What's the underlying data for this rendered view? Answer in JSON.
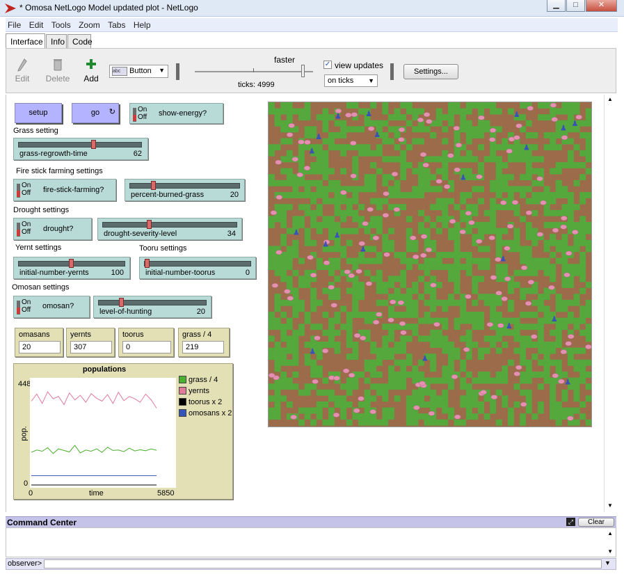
{
  "window": {
    "title": "* Omosa NetLogo Model updated plot - NetLogo",
    "min": "▁",
    "max": "□",
    "close": "✕"
  },
  "menu": [
    "File",
    "Edit",
    "Tools",
    "Zoom",
    "Tabs",
    "Help"
  ],
  "tabs": [
    "Interface",
    "Info",
    "Code"
  ],
  "toolbar": {
    "edit": "Edit",
    "delete": "Delete",
    "add": "Add",
    "widget_type": "Button",
    "faster": "faster",
    "speed": 0.93,
    "ticks": "ticks: 4999",
    "view_updates": "view updates",
    "update_mode": "on ticks",
    "settings": "Settings..."
  },
  "buttons": {
    "setup": "setup",
    "go": "go"
  },
  "switches": {
    "on": "On",
    "off": "Off",
    "show_energy": "show-energy?",
    "fire": "fire-stick-farming?",
    "drought": "drought?",
    "omosan": "omosan?"
  },
  "sections": {
    "grass": "Grass setting",
    "fire": "Fire stick farming settings",
    "drought": "Drought settings",
    "yernt": "Yernt settings",
    "tooru": "Tooru settings",
    "omosan": "Omosan settings"
  },
  "sliders": {
    "grass_regrowth": {
      "name": "grass-regrowth-time",
      "value": "62",
      "level": 0.62
    },
    "percent_burned": {
      "name": "percent-burned-grass",
      "value": "20",
      "level": 0.2
    },
    "drought_severity": {
      "name": "drought-severity-level",
      "value": "34",
      "level": 0.34
    },
    "yernts": {
      "name": "initial-number-yernts",
      "value": "100",
      "level": 0.5
    },
    "toorus": {
      "name": "initial-number-toorus",
      "value": "0",
      "level": 0.0
    },
    "hunting": {
      "name": "level-of-hunting",
      "value": "20",
      "level": 0.2
    }
  },
  "monitors": [
    {
      "name": "omasans",
      "value": "20"
    },
    {
      "name": "yernts",
      "value": "307"
    },
    {
      "name": "toorus",
      "value": "0"
    },
    {
      "name": "grass / 4",
      "value": "219"
    }
  ],
  "plot": {
    "title": "populations",
    "ymax": "448",
    "ymin": "0",
    "xmin": "0",
    "xmax": "5850",
    "xlabel": "time",
    "ylabel": "pop."
  },
  "chart_data": {
    "type": "line",
    "title": "populations",
    "xlabel": "time",
    "ylabel": "pop.",
    "xlim": [
      0,
      5850
    ],
    "ylim": [
      0,
      448
    ],
    "series": [
      {
        "name": "grass / 4",
        "color": "#4caf2f",
        "values": [
          140,
          150,
          145,
          160,
          135,
          155,
          148,
          142,
          170,
          138,
          150,
          145,
          155,
          140,
          162,
          148,
          150,
          143,
          158,
          146,
          151,
          147,
          155,
          149
        ]
      },
      {
        "name": "yernts",
        "color": "#e07a9a",
        "values": [
          360,
          390,
          350,
          400,
          370,
          380,
          345,
          395,
          365,
          385,
          355,
          392,
          372,
          360,
          388,
          350,
          398,
          362,
          380,
          370,
          355,
          390,
          366,
          330
        ]
      },
      {
        "name": "toorus x 2",
        "color": "#000000",
        "values": [
          0,
          0,
          0,
          0,
          0,
          0,
          0,
          0,
          0,
          0,
          0,
          0,
          0,
          0,
          0,
          0,
          0,
          0,
          0,
          0,
          0,
          0,
          0,
          0
        ]
      },
      {
        "name": "omosans x 2",
        "color": "#3556b8",
        "values": [
          40,
          40,
          40,
          40,
          40,
          40,
          40,
          40,
          40,
          40,
          40,
          40,
          40,
          40,
          40,
          40,
          40,
          40,
          40,
          40,
          40,
          40,
          40,
          40
        ]
      }
    ]
  },
  "command": {
    "title": "Command Center",
    "clear": "Clear",
    "observer": "observer>"
  }
}
